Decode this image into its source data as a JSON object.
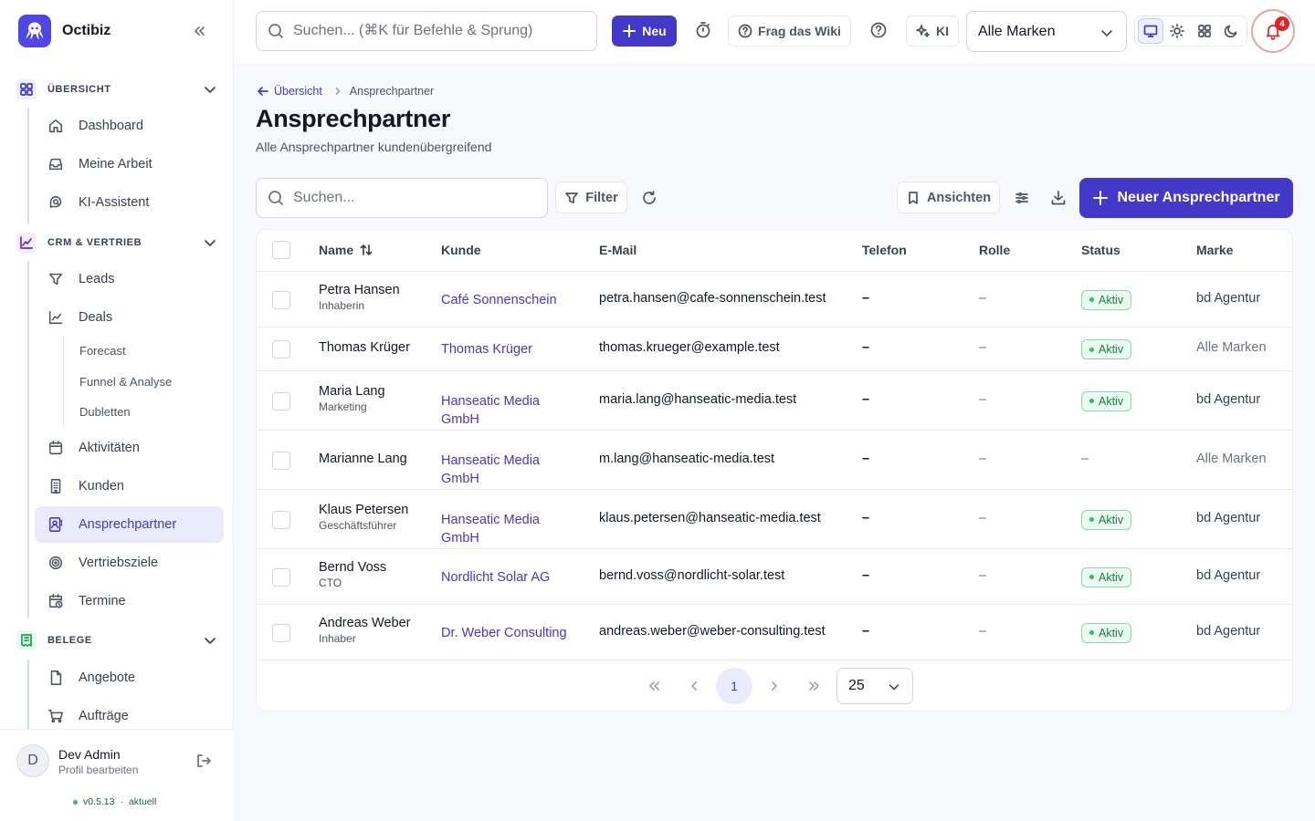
{
  "app": {
    "name": "Octibiz"
  },
  "topbar": {
    "search_placeholder": "Suchen... (⌘K für Befehle & Sprung)",
    "new_label": "Neu",
    "wiki_label": "Frag das Wiki",
    "ai_label": "KI",
    "brand_select_value": "Alle Marken",
    "notification_count": "4"
  },
  "sidebar": {
    "sections": [
      {
        "label": "ÜBERSICHT",
        "items": [
          "Dashboard",
          "Meine Arbeit",
          "KI-Assistent"
        ]
      },
      {
        "label": "CRM & VERTRIEB",
        "items": [
          "Leads",
          "Deals",
          "Aktivitäten",
          "Kunden",
          "Ansprechpartner",
          "Vertriebsziele",
          "Termine"
        ],
        "deal_subitems": [
          "Forecast",
          "Funnel & Analyse",
          "Dubletten"
        ]
      },
      {
        "label": "BELEGE",
        "items": [
          "Angebote",
          "Aufträge"
        ]
      }
    ],
    "active_item": "Ansprechpartner",
    "user": {
      "initial": "D",
      "name": "Dev Admin",
      "subtitle": "Profil bearbeiten"
    },
    "version": {
      "number": "v0.5.13",
      "state": "aktuell"
    }
  },
  "breadcrumb": {
    "back": "Übersicht",
    "current": "Ansprechpartner"
  },
  "page": {
    "title": "Ansprechpartner",
    "subtitle": "Alle Ansprechpartner kundenübergreifend"
  },
  "toolbar": {
    "search_placeholder": "Suchen...",
    "filter_label": "Filter",
    "views_label": "Ansichten",
    "new_contact_label": "Neuer Ansprechpartner"
  },
  "table": {
    "columns": [
      "Name",
      "Kunde",
      "E-Mail",
      "Telefon",
      "Rolle",
      "Status",
      "Marke"
    ],
    "rows": [
      {
        "name": "Petra Hansen",
        "title": "Inhaberin",
        "kunde": "Café Sonnenschein",
        "email": "petra.hansen@cafe-sonnenschein.test",
        "telefon": "–",
        "rolle": "–",
        "status": "Aktiv",
        "marke": "bd Agentur"
      },
      {
        "name": "Thomas Krüger",
        "title": "",
        "kunde": "Thomas Krüger",
        "email": "thomas.krueger@example.test",
        "telefon": "–",
        "rolle": "–",
        "status": "Aktiv",
        "marke": "Alle Marken"
      },
      {
        "name": "Maria Lang",
        "title": "Marketing",
        "kunde": "Hanseatic Media GmbH",
        "email": "maria.lang@hanseatic-media.test",
        "telefon": "–",
        "rolle": "–",
        "status": "Aktiv",
        "marke": "bd Agentur"
      },
      {
        "name": "Marianne Lang",
        "title": "",
        "kunde": "Hanseatic Media GmbH",
        "email": "m.lang@hanseatic-media.test",
        "telefon": "–",
        "rolle": "–",
        "status": "–",
        "marke": "Alle Marken"
      },
      {
        "name": "Klaus Petersen",
        "title": "Geschäftsführer",
        "kunde": "Hanseatic Media GmbH",
        "email": "klaus.petersen@hanseatic-media.test",
        "telefon": "–",
        "rolle": "–",
        "status": "Aktiv",
        "marke": "bd Agentur"
      },
      {
        "name": "Bernd Voss",
        "title": "CTO",
        "kunde": "Nordlicht Solar AG",
        "email": "bernd.voss@nordlicht-solar.test",
        "telefon": "–",
        "rolle": "–",
        "status": "Aktiv",
        "marke": "bd Agentur"
      },
      {
        "name": "Andreas Weber",
        "title": "Inhaber",
        "kunde": "Dr. Weber Consulting",
        "email": "andreas.weber@weber-consulting.test",
        "telefon": "–",
        "rolle": "–",
        "status": "Aktiv",
        "marke": "bd Agentur"
      }
    ]
  },
  "pagination": {
    "current_page": "1",
    "page_size": "25"
  },
  "colors": {
    "accent": "#4338ca",
    "active_bg": "#ebeafd",
    "status_green": "#15803d",
    "danger": "#dc2626"
  }
}
